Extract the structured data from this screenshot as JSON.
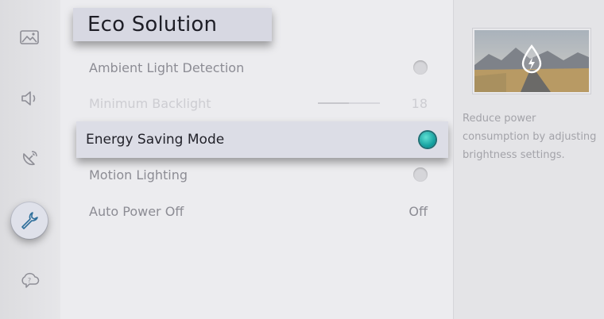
{
  "sidebar": {
    "items": [
      {
        "name": "picture",
        "icon": "picture-icon",
        "active": false
      },
      {
        "name": "sound",
        "icon": "speaker-icon",
        "active": false
      },
      {
        "name": "broadcasting",
        "icon": "satellite-dish-icon",
        "active": false
      },
      {
        "name": "general",
        "icon": "wrench-icon",
        "active": true
      },
      {
        "name": "support",
        "icon": "cloud-question-icon",
        "active": false
      }
    ]
  },
  "header": {
    "title": "Eco Solution"
  },
  "menu": {
    "ambient_light": {
      "label": "Ambient Light Detection",
      "enabled": false
    },
    "min_backlight": {
      "label": "Minimum Backlight",
      "value": "18",
      "level": 0.5
    },
    "energy_saving": {
      "label": "Energy Saving Mode",
      "enabled": true
    },
    "motion_lighting": {
      "label": "Motion Lighting",
      "enabled": false
    },
    "auto_power_off": {
      "label": "Auto Power Off",
      "value": "Off"
    }
  },
  "info": {
    "description": "Reduce power consumption by adjusting brightness settings.",
    "thumbnail_icon": "eco-drop-icon"
  },
  "colors": {
    "accent": "#12a3a3",
    "focus_bg": "#dcdde6"
  }
}
